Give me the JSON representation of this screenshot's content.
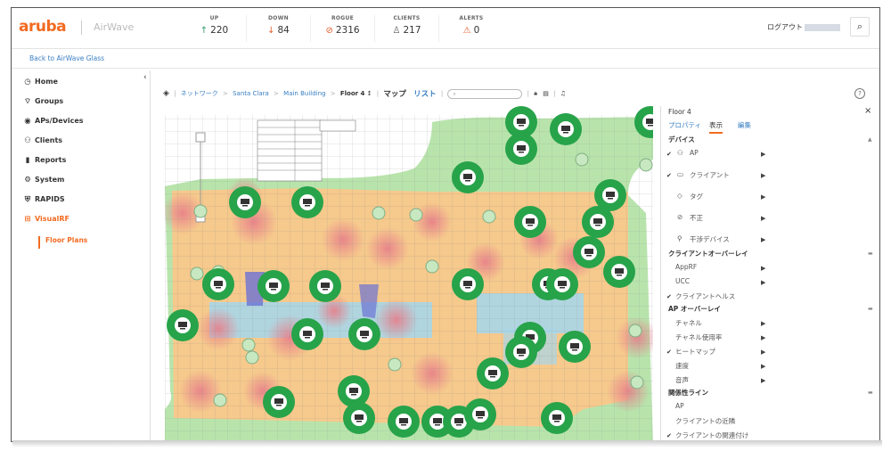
{
  "app": {
    "logo": "aruba",
    "product": "AirWave"
  },
  "stats": [
    {
      "label": "UP",
      "icon": "↑",
      "value": "220",
      "color": "#2e9a6a"
    },
    {
      "label": "DOWN",
      "icon": "↓",
      "value": "84",
      "color": "#e25d2b"
    },
    {
      "label": "ROGUE",
      "icon": "⊘",
      "value": "2316",
      "color": "#e25d2b"
    },
    {
      "label": "CLIENTS",
      "icon": "♙",
      "value": "217",
      "color": "#555555"
    },
    {
      "label": "ALERTS",
      "icon": "⚠",
      "value": "0",
      "color": "#e25d2b"
    }
  ],
  "header": {
    "logout": "ログアウト"
  },
  "back_link": "Back to AirWave Glass",
  "sidebar": {
    "items": [
      {
        "label": "Home",
        "icon": "◷"
      },
      {
        "label": "Groups",
        "icon": "⌔"
      },
      {
        "label": "APs/Devices",
        "icon": "◉"
      },
      {
        "label": "Clients",
        "icon": "⚇"
      },
      {
        "label": "Reports",
        "icon": "▮"
      },
      {
        "label": "System",
        "icon": "⚙"
      },
      {
        "label": "RAPIDS",
        "icon": "⛨"
      },
      {
        "label": "VisualRF",
        "icon": "⊞"
      }
    ],
    "subitem": "Floor Plans"
  },
  "toolbar": {
    "crumbs": [
      "ネットワーク",
      "Santa Clara",
      "Main Building"
    ],
    "current": "Floor 4",
    "view_map": "マップ",
    "view_list": "リスト"
  },
  "panel": {
    "title": "Floor 4",
    "tabs": [
      "プロパティ",
      "表示",
      "編集"
    ],
    "sections": {
      "devices": "デバイス",
      "client_overlay": "クライアントオーバーレイ",
      "ap_overlay": "AP オーバーレイ",
      "relations": "関係性ライン"
    },
    "device_items": [
      "AP",
      "クライアント",
      "タグ",
      "不正",
      "干渉デバイス"
    ],
    "client_overlay_items": [
      "AppRF",
      "UCC",
      "クライアントヘルス"
    ],
    "ap_overlay_items": [
      "チャネル",
      "チャネル使用率",
      "ヒートマップ",
      "速度",
      "音声"
    ],
    "relation_items": [
      "AP",
      "クライアントの近隣",
      "クライアントの関連付け"
    ]
  },
  "colors": {
    "accent": "#f26b21",
    "link": "#3a7fc2",
    "ap_green": "#27a34a",
    "heat_green": "#b9e6ad",
    "heat_orange": "#f6c98c",
    "heat_red": "#ea8f99",
    "heat_blue": "#a8d6e8"
  }
}
